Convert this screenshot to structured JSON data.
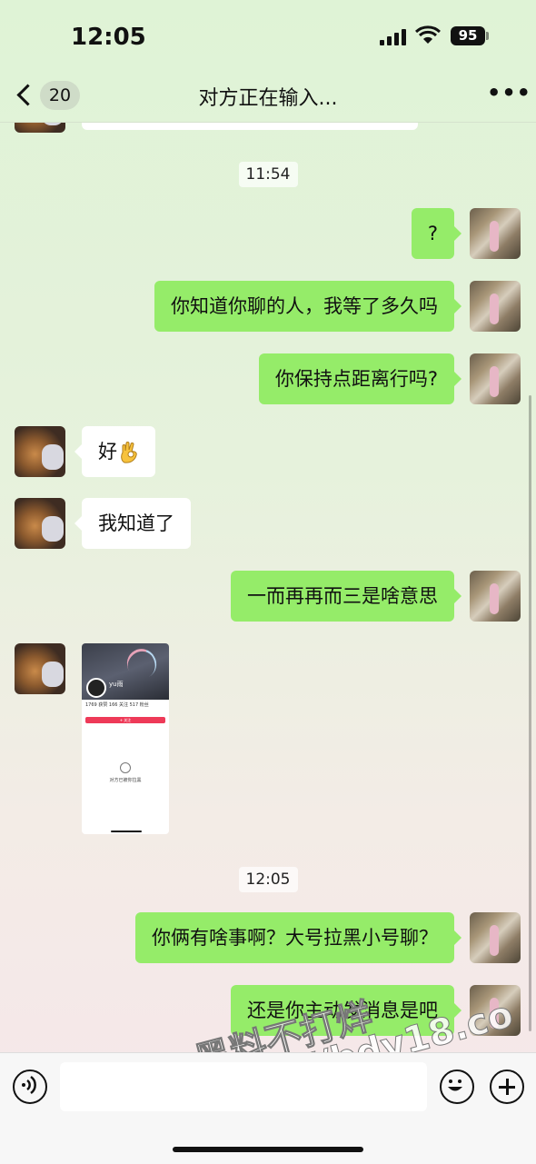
{
  "status_bar": {
    "time": "12:05",
    "battery": "95"
  },
  "nav": {
    "unread_count": "20",
    "title": "对方正在输入..."
  },
  "timestamps": [
    "11:54",
    "12:05"
  ],
  "messages": [
    {
      "side": "out",
      "text": "?"
    },
    {
      "side": "out",
      "text": "你知道你聊的人，我等了多久吗"
    },
    {
      "side": "out",
      "text": "你保持点距离行吗?"
    },
    {
      "side": "in",
      "text": "好",
      "emoji": "ok-hand-icon"
    },
    {
      "side": "in",
      "text": "我知道了"
    },
    {
      "side": "out",
      "text": "一而再再而三是啥意思"
    },
    {
      "side": "in",
      "type": "image"
    },
    {
      "side": "out",
      "text": "你俩有啥事啊？大号拉黑小号聊？"
    },
    {
      "side": "out",
      "text": "还是你主动发消息是吧"
    }
  ],
  "image_message": {
    "profile_name": "yu雨",
    "stats": "1769 获赞  166 关注  517 粉丝",
    "follow_label": "+ 关注",
    "blocked_text": "对方已被你拉黑"
  },
  "watermark": {
    "line1": "黑料不打烊",
    "line2": "https://bdy18.co"
  },
  "colors": {
    "outgoing_bubble": "#95ec69",
    "incoming_bubble": "#ffffff"
  }
}
